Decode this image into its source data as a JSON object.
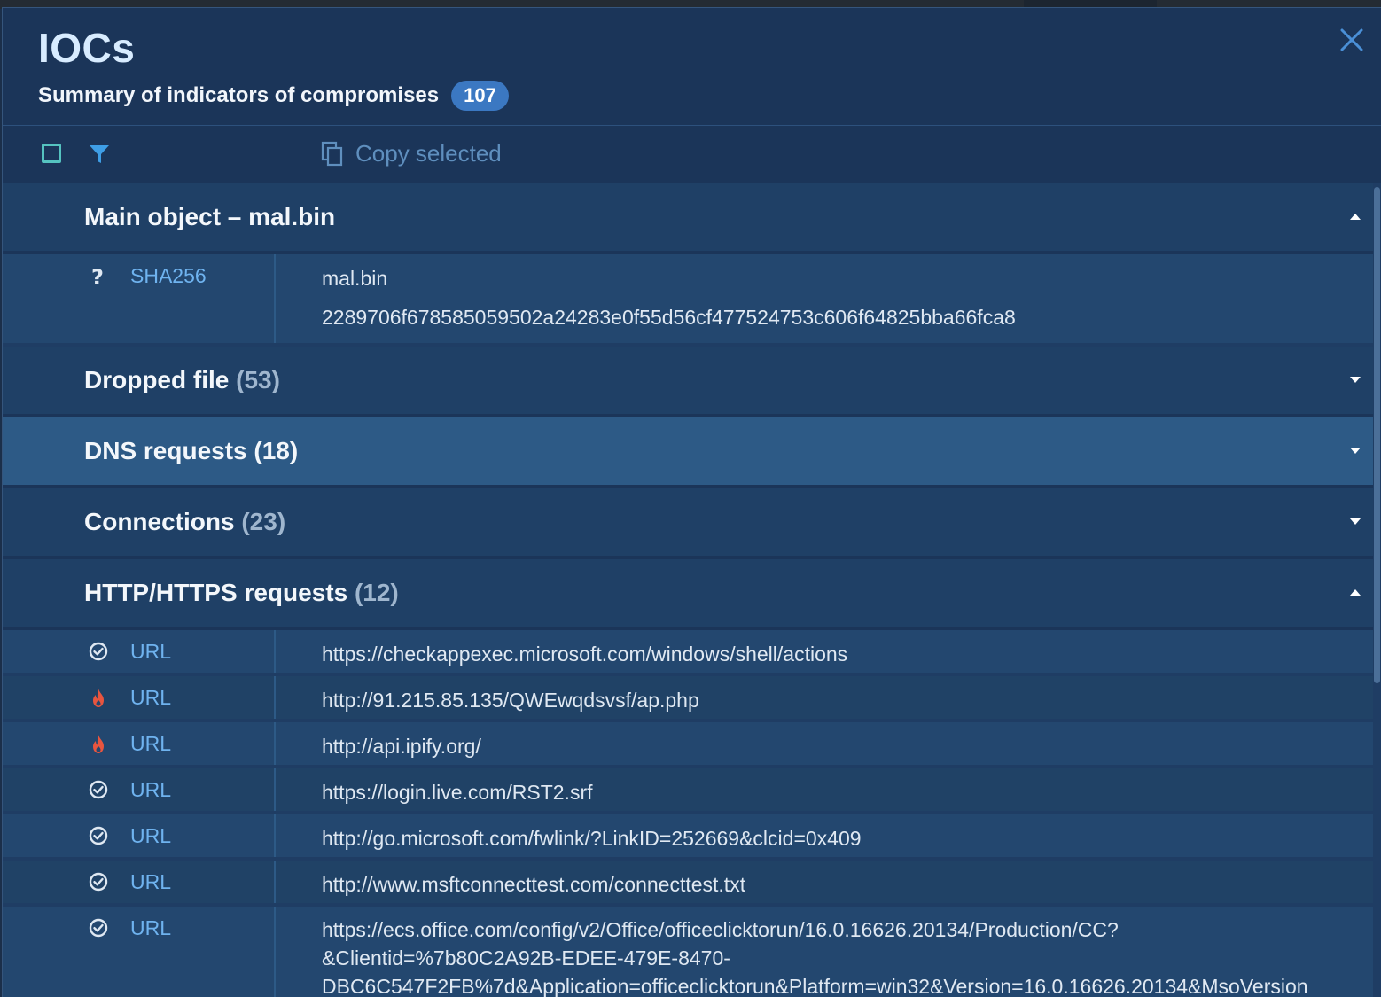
{
  "header": {
    "title": "IOCs",
    "subtitle": "Summary of indicators of compromises",
    "count": "107"
  },
  "toolbar": {
    "copy_label": "Copy selected"
  },
  "main_object": {
    "title": "Main object  – mal.bin",
    "row": {
      "status_icon": "question-icon",
      "type": "SHA256",
      "name": "mal.bin",
      "hash": "2289706f678585059502a24283e0f55d56cf477524753c606f64825bba66fca8"
    }
  },
  "sections": {
    "dropped": {
      "label": "Dropped file",
      "count": "(53)"
    },
    "dns": {
      "label": "DNS requests",
      "count": "(18)"
    },
    "connections": {
      "label": "Connections",
      "count": "(23)"
    },
    "http": {
      "label": "HTTP/HTTPS requests",
      "count": "(12)"
    }
  },
  "http_rows": [
    {
      "status_icon": "check-circle-icon",
      "type": "URL",
      "value": "https://checkappexec.microsoft.com/windows/shell/actions"
    },
    {
      "status_icon": "fire-icon",
      "type": "URL",
      "value": "http://91.215.85.135/QWEwqdsvsf/ap.php"
    },
    {
      "status_icon": "fire-icon",
      "type": "URL",
      "value": "http://api.ipify.org/"
    },
    {
      "status_icon": "check-circle-icon",
      "type": "URL",
      "value": "https://login.live.com/RST2.srf"
    },
    {
      "status_icon": "check-circle-icon",
      "type": "URL",
      "value": "http://go.microsoft.com/fwlink/?LinkID=252669&clcid=0x409"
    },
    {
      "status_icon": "check-circle-icon",
      "type": "URL",
      "value": "http://www.msftconnecttest.com/connecttest.txt"
    },
    {
      "status_icon": "check-circle-icon",
      "type": "URL",
      "value": "https://ecs.office.com/config/v2/Office/officeclicktorun/16.0.16626.20134/Production/CC?\n&Clientid=%7b80C2A92B-EDEE-479E-8470-\nDBC6C547F2FB%7d&Application=officeclicktorun&Platform=win32&Version=16.0.16626.20134&MsoVersion"
    }
  ],
  "colors": {
    "accent": "#3b78c2",
    "link": "#6fb3ef",
    "danger": "#e8553f",
    "ok": "#dfe8f2"
  }
}
